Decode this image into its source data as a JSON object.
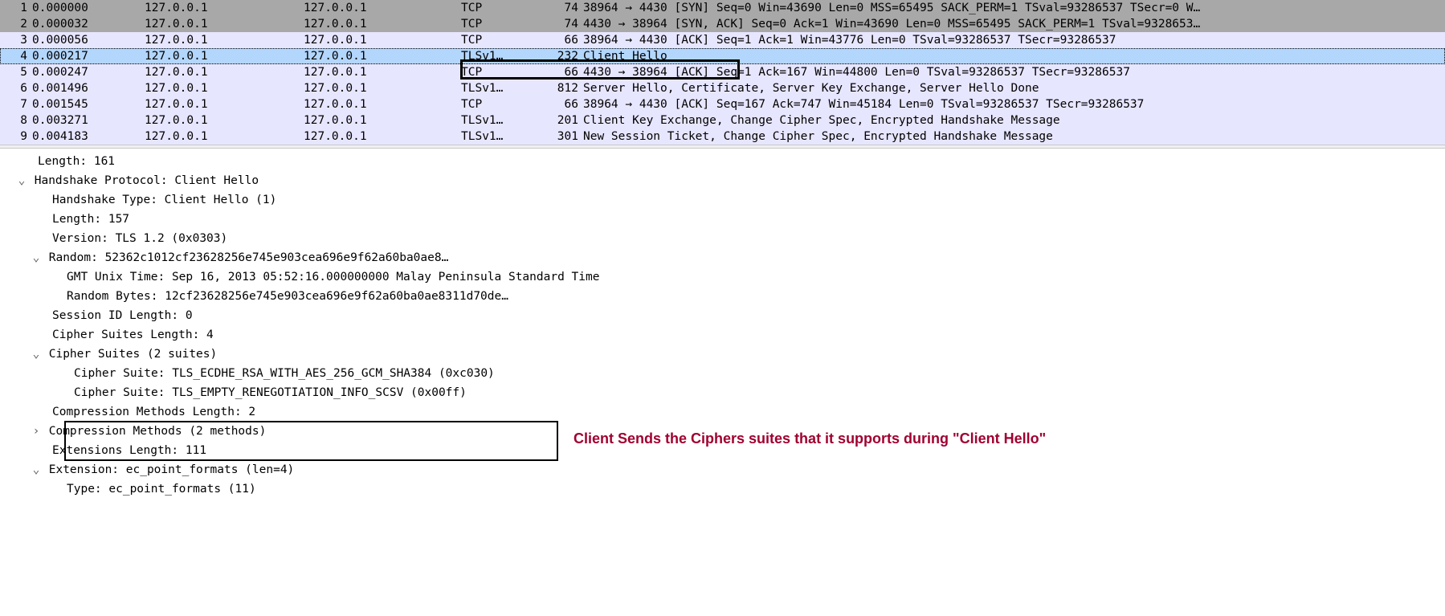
{
  "packets": [
    {
      "no": "1",
      "time": "0.000000",
      "src": "127.0.0.1",
      "dst": "127.0.0.1",
      "proto": "TCP",
      "len": "74",
      "info": "38964 → 4430 [SYN] Seq=0 Win=43690 Len=0 MSS=65495 SACK_PERM=1 TSval=93286537 TSecr=0 W…",
      "cls": "gray"
    },
    {
      "no": "2",
      "time": "0.000032",
      "src": "127.0.0.1",
      "dst": "127.0.0.1",
      "proto": "TCP",
      "len": "74",
      "info": "4430 → 38964 [SYN, ACK] Seq=0 Ack=1 Win=43690 Len=0 MSS=65495 SACK_PERM=1 TSval=9328653…",
      "cls": "gray"
    },
    {
      "no": "3",
      "time": "0.000056",
      "src": "127.0.0.1",
      "dst": "127.0.0.1",
      "proto": "TCP",
      "len": "66",
      "info": "38964 → 4430 [ACK] Seq=1 Ack=1 Win=43776 Len=0 TSval=93286537 TSecr=93286537",
      "cls": "tcp"
    },
    {
      "no": "4",
      "time": "0.000217",
      "src": "127.0.0.1",
      "dst": "127.0.0.1",
      "proto": "TLSv1…",
      "len": "232",
      "info": "Client Hello",
      "cls": "sel"
    },
    {
      "no": "5",
      "time": "0.000247",
      "src": "127.0.0.1",
      "dst": "127.0.0.1",
      "proto": "TCP",
      "len": "66",
      "info": "4430 → 38964 [ACK] Seq=1 Ack=167 Win=44800 Len=0 TSval=93286537 TSecr=93286537",
      "cls": "tcp"
    },
    {
      "no": "6",
      "time": "0.001496",
      "src": "127.0.0.1",
      "dst": "127.0.0.1",
      "proto": "TLSv1…",
      "len": "812",
      "info": "Server Hello, Certificate, Server Key Exchange, Server Hello Done",
      "cls": "tcp"
    },
    {
      "no": "7",
      "time": "0.001545",
      "src": "127.0.0.1",
      "dst": "127.0.0.1",
      "proto": "TCP",
      "len": "66",
      "info": "38964 → 4430 [ACK] Seq=167 Ack=747 Win=45184 Len=0 TSval=93286537 TSecr=93286537",
      "cls": "tcp"
    },
    {
      "no": "8",
      "time": "0.003271",
      "src": "127.0.0.1",
      "dst": "127.0.0.1",
      "proto": "TLSv1…",
      "len": "201",
      "info": "Client Key Exchange, Change Cipher Spec, Encrypted Handshake Message",
      "cls": "tcp"
    },
    {
      "no": "9",
      "time": "0.004183",
      "src": "127.0.0.1",
      "dst": "127.0.0.1",
      "proto": "TLSv1…",
      "len": "301",
      "info": "New Session Ticket, Change Cipher Spec, Encrypted Handshake Message",
      "cls": "tcp"
    }
  ],
  "tree": [
    {
      "indent": 47,
      "tw": "",
      "text": "Length: 161"
    },
    {
      "indent": 20,
      "tw": "⌄",
      "text": "Handshake Protocol: Client Hello"
    },
    {
      "indent": 65,
      "tw": "",
      "text": "Handshake Type: Client Hello (1)"
    },
    {
      "indent": 65,
      "tw": "",
      "text": "Length: 157"
    },
    {
      "indent": 65,
      "tw": "",
      "text": "Version: TLS 1.2 (0x0303)"
    },
    {
      "indent": 38,
      "tw": "⌄",
      "text": "Random: 52362c1012cf23628256e745e903cea696e9f62a60ba0ae8…"
    },
    {
      "indent": 83,
      "tw": "",
      "text": "GMT Unix Time: Sep 16, 2013 05:52:16.000000000 Malay Peninsula Standard Time"
    },
    {
      "indent": 83,
      "tw": "",
      "text": "Random Bytes: 12cf23628256e745e903cea696e9f62a60ba0ae8311d70de…"
    },
    {
      "indent": 65,
      "tw": "",
      "text": "Session ID Length: 0"
    },
    {
      "indent": 65,
      "tw": "",
      "text": "Cipher Suites Length: 4"
    },
    {
      "indent": 38,
      "tw": "⌄",
      "text": "Cipher Suites (2 suites)"
    },
    {
      "indent": 92,
      "tw": "",
      "text": "Cipher Suite: TLS_ECDHE_RSA_WITH_AES_256_GCM_SHA384 (0xc030)"
    },
    {
      "indent": 92,
      "tw": "",
      "text": "Cipher Suite: TLS_EMPTY_RENEGOTIATION_INFO_SCSV (0x00ff)"
    },
    {
      "indent": 65,
      "tw": "",
      "text": "Compression Methods Length: 2"
    },
    {
      "indent": 38,
      "tw": "›",
      "text": "Compression Methods (2 methods)"
    },
    {
      "indent": 65,
      "tw": "",
      "text": "Extensions Length: 111"
    },
    {
      "indent": 38,
      "tw": "⌄",
      "text": "Extension: ec_point_formats (len=4)"
    },
    {
      "indent": 83,
      "tw": "",
      "text": "Type: ec_point_formats (11)"
    }
  ],
  "annotation": "Client Sends the Ciphers suites that it supports during \"Client Hello\""
}
